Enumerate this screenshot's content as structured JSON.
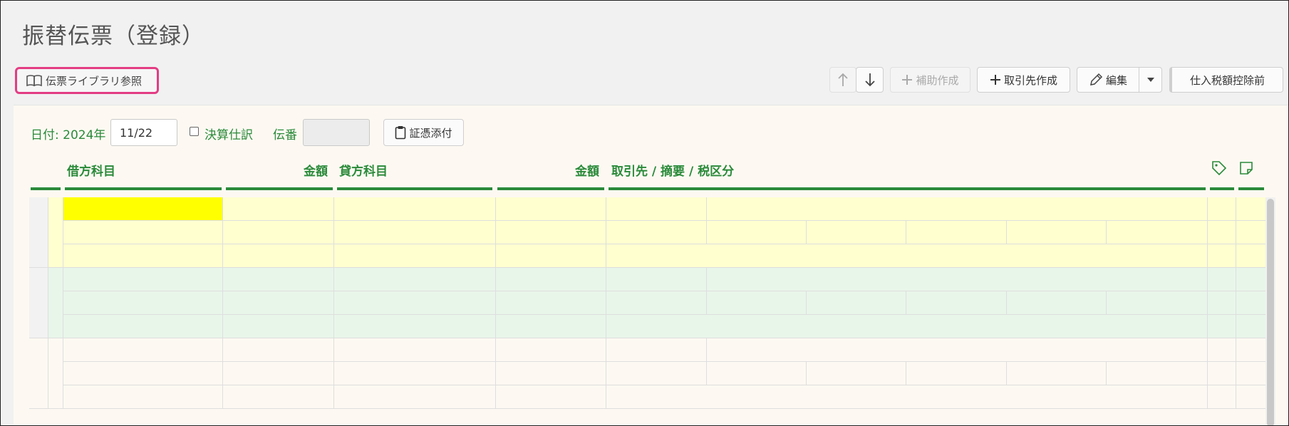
{
  "page": {
    "title": "振替伝票（登録）"
  },
  "toolbar": {
    "library_label": "伝票ライブラリ参照",
    "move_up_icon": "arrow-up-icon",
    "move_down_icon": "arrow-down-icon",
    "aux_create_label": "補助作成",
    "partner_create_label": "取引先作成",
    "edit_label": "編集",
    "tax_deduction_label": "仕入税額控除前"
  },
  "form": {
    "date_label": "日付: 2024年",
    "date_value": "11/22",
    "closing_label": "決算仕訳",
    "closing_checked": false,
    "voucher_no_label": "伝番",
    "voucher_no_value": "",
    "attach_label": "証憑添付"
  },
  "table": {
    "headers": {
      "debit_account": "借方科目",
      "debit_amount": "金額",
      "credit_account": "貸方科目",
      "credit_amount": "金額",
      "partner_memo_tax": "取引先 / 摘要 / 税区分",
      "tag_icon": "tag-icon",
      "note_icon": "sticky-note-icon"
    },
    "rows": [
      {
        "debit_account": "",
        "debit_amount": "",
        "credit_account": "",
        "credit_amount": "",
        "partner": "",
        "memo": "",
        "tax": "",
        "state": "selected"
      },
      {
        "debit_account": "",
        "debit_amount": "",
        "credit_account": "",
        "credit_amount": "",
        "partner": "",
        "memo": "",
        "tax": "",
        "state": "alternate"
      },
      {
        "debit_account": "",
        "debit_amount": "",
        "credit_account": "",
        "credit_amount": "",
        "partner": "",
        "memo": "",
        "tax": "",
        "state": "empty"
      }
    ]
  },
  "colors": {
    "accent_green": "#2a8a3a",
    "highlight_pink": "#e33d84",
    "row_selected_bg": "#ffffd0",
    "cell_active_bg": "#ffff00",
    "row_alt_bg": "#e8f6ea",
    "panel_bg": "#fdf9f2"
  }
}
